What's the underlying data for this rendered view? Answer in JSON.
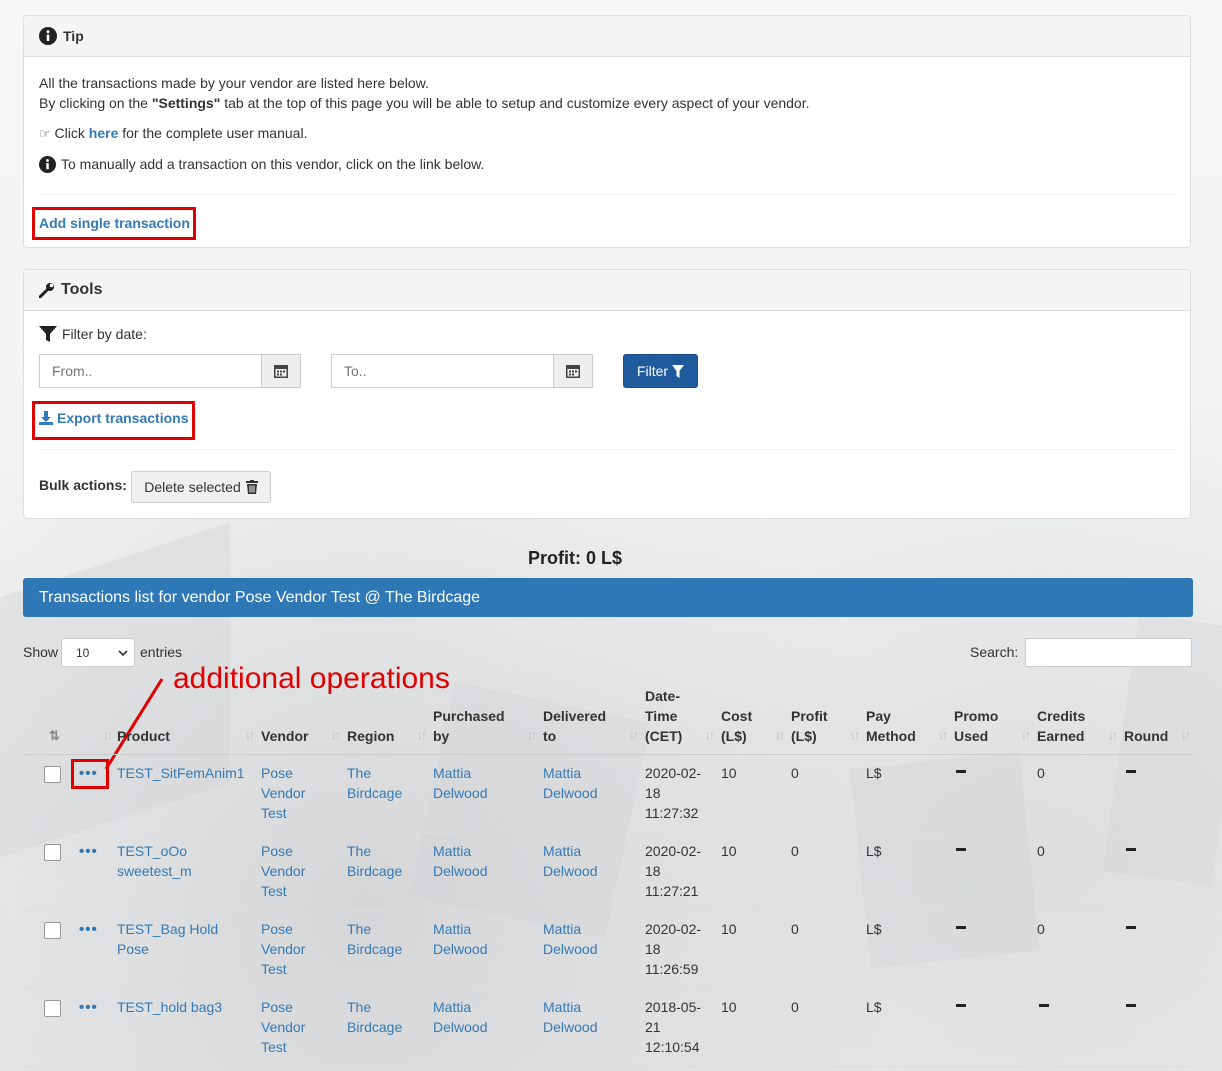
{
  "tip": {
    "title": "Tip",
    "line1": "All the transactions made by your vendor are listed here below.",
    "line2_pre": "By clicking on the ",
    "line2_bold": "\"Settings\"",
    "line2_post": " tab at the top of this page you will be able to setup and customize every aspect of your vendor.",
    "manual_pre": "Click ",
    "manual_link": "here",
    "manual_post": " for the complete user manual.",
    "manual_add": "To manually add a transaction on this vendor, click on the link below.",
    "add_link": "Add single transaction"
  },
  "tools": {
    "title": "Tools",
    "filter_label": "Filter by date:",
    "from_placeholder": "From..",
    "to_placeholder": "To..",
    "filter_button": "Filter",
    "export_link": "Export transactions",
    "bulk_label": "Bulk actions:",
    "delete_button": "Delete selected"
  },
  "profit": "Profit: 0 L$",
  "list_title": "Transactions list for vendor Pose Vendor Test @ The Birdcage",
  "show_label": "Show",
  "entries_value": "10",
  "entries_label": "entries",
  "search_label": "Search:",
  "annotation": "additional operations",
  "colors": {
    "primary": "#2e78b6",
    "button_dark": "#1e5a9c",
    "annotation_red": "#e00000"
  },
  "columns": [
    {
      "l1": "",
      "l2": "Product"
    },
    {
      "l1": "",
      "l2": "Vendor"
    },
    {
      "l1": "",
      "l2": "Region"
    },
    {
      "l1": "Purchased",
      "l2": "by"
    },
    {
      "l1": "Delivered",
      "l2": "to"
    },
    {
      "l1": "Date-",
      "l1b": "Time",
      "l2": "(CET)"
    },
    {
      "l1": "Cost",
      "l2": "(L$)"
    },
    {
      "l1": "Profit",
      "l2": "(L$)"
    },
    {
      "l1": "Pay",
      "l2": "Method"
    },
    {
      "l1": "Promo",
      "l2": "Used"
    },
    {
      "l1": "Credits",
      "l2": "Earned"
    },
    {
      "l1": "",
      "l2": "Round"
    }
  ],
  "rows": [
    {
      "product": [
        "TEST_SitFemAnim1"
      ],
      "vendor": [
        "Pose",
        "Vendor",
        "Test"
      ],
      "region": [
        "The",
        "Birdcage"
      ],
      "purchased": [
        "Mattia",
        "Delwood"
      ],
      "delivered": [
        "Mattia",
        "Delwood"
      ],
      "date": [
        "2020-02-",
        "18",
        "11:27:32"
      ],
      "cost": "10",
      "profit": "0",
      "pay": "L$",
      "credits": "0"
    },
    {
      "product": [
        "TEST_oOo",
        "sweetest_m"
      ],
      "vendor": [
        "Pose",
        "Vendor",
        "Test"
      ],
      "region": [
        "The",
        "Birdcage"
      ],
      "purchased": [
        "Mattia",
        "Delwood"
      ],
      "delivered": [
        "Mattia",
        "Delwood"
      ],
      "date": [
        "2020-02-",
        "18",
        "11:27:21"
      ],
      "cost": "10",
      "profit": "0",
      "pay": "L$",
      "credits": "0"
    },
    {
      "product": [
        "TEST_Bag Hold",
        "Pose"
      ],
      "vendor": [
        "Pose",
        "Vendor",
        "Test"
      ],
      "region": [
        "The",
        "Birdcage"
      ],
      "purchased": [
        "Mattia",
        "Delwood"
      ],
      "delivered": [
        "Mattia",
        "Delwood"
      ],
      "date": [
        "2020-02-",
        "18",
        "11:26:59"
      ],
      "cost": "10",
      "profit": "0",
      "pay": "L$",
      "credits": "0"
    },
    {
      "product": [
        "TEST_hold bag3"
      ],
      "vendor": [
        "Pose",
        "Vendor",
        "Test"
      ],
      "region": [
        "The",
        "Birdcage"
      ],
      "purchased": [
        "Mattia",
        "Delwood"
      ],
      "delivered": [
        "Mattia",
        "Delwood"
      ],
      "date": [
        "2018-05-",
        "21",
        "12:10:54"
      ],
      "cost": "10",
      "profit": "0",
      "pay": "L$",
      "credits": ""
    }
  ]
}
